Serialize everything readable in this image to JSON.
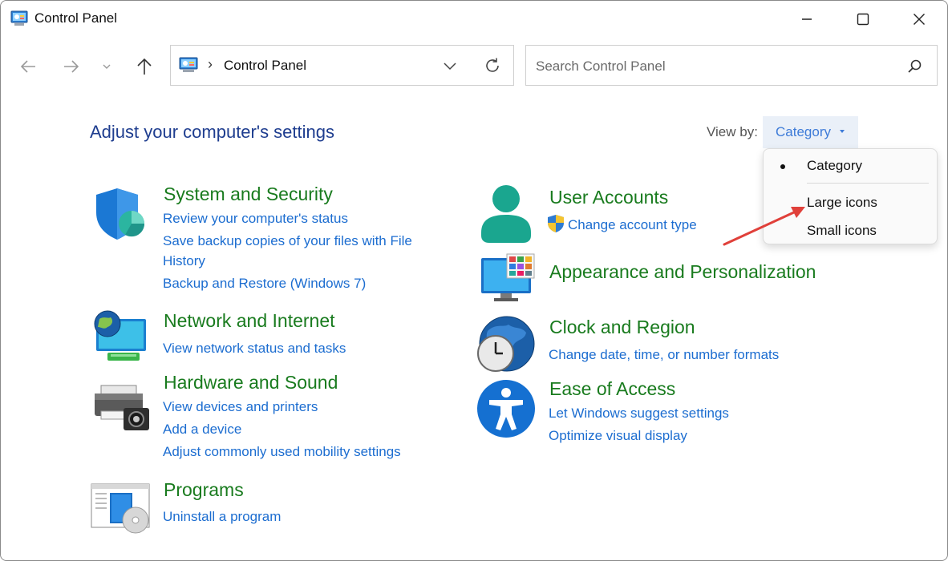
{
  "window": {
    "title": "Control Panel"
  },
  "address": {
    "path": "Control Panel"
  },
  "search": {
    "placeholder": "Search Control Panel"
  },
  "main": {
    "heading": "Adjust your computer's settings",
    "view_by_label": "View by:",
    "view_by_value": "Category",
    "view_menu": {
      "options": [
        "Category",
        "Large icons",
        "Small icons"
      ],
      "selected": "Category"
    }
  },
  "categories": {
    "system_security": {
      "title": "System and Security",
      "links": [
        "Review your computer's status",
        "Save backup copies of your files with File",
        "History",
        "Backup and Restore (Windows 7)"
      ]
    },
    "network": {
      "title": "Network and Internet",
      "links": [
        "View network status and tasks"
      ]
    },
    "hardware": {
      "title": "Hardware and Sound",
      "links": [
        "View devices and printers",
        "Add a device",
        "Adjust commonly used mobility settings"
      ]
    },
    "programs": {
      "title": "Programs",
      "links": [
        "Uninstall a program"
      ]
    },
    "user_accounts": {
      "title": "User Accounts",
      "links": [
        "Change account type"
      ]
    },
    "appearance": {
      "title": "Appearance and Personalization",
      "links": []
    },
    "clock": {
      "title": "Clock and Region",
      "links": [
        "Change date, time, or number formats"
      ]
    },
    "ease": {
      "title": "Ease of Access",
      "links": [
        "Let Windows suggest settings",
        "Optimize visual display"
      ]
    }
  },
  "colors": {
    "heading": "#1e3d8f",
    "category_title": "#197b1e",
    "link": "#1c6dd0",
    "annotation_arrow": "#e0403a"
  },
  "icons": {
    "title": "control-panel-icon",
    "back": "arrow-left-icon",
    "forward": "arrow-right-icon",
    "recent": "chevron-down-icon",
    "up": "arrow-up-icon",
    "refresh": "refresh-icon",
    "search": "search-icon",
    "minimize": "minimize-icon",
    "maximize": "maximize-icon",
    "close": "close-icon"
  }
}
